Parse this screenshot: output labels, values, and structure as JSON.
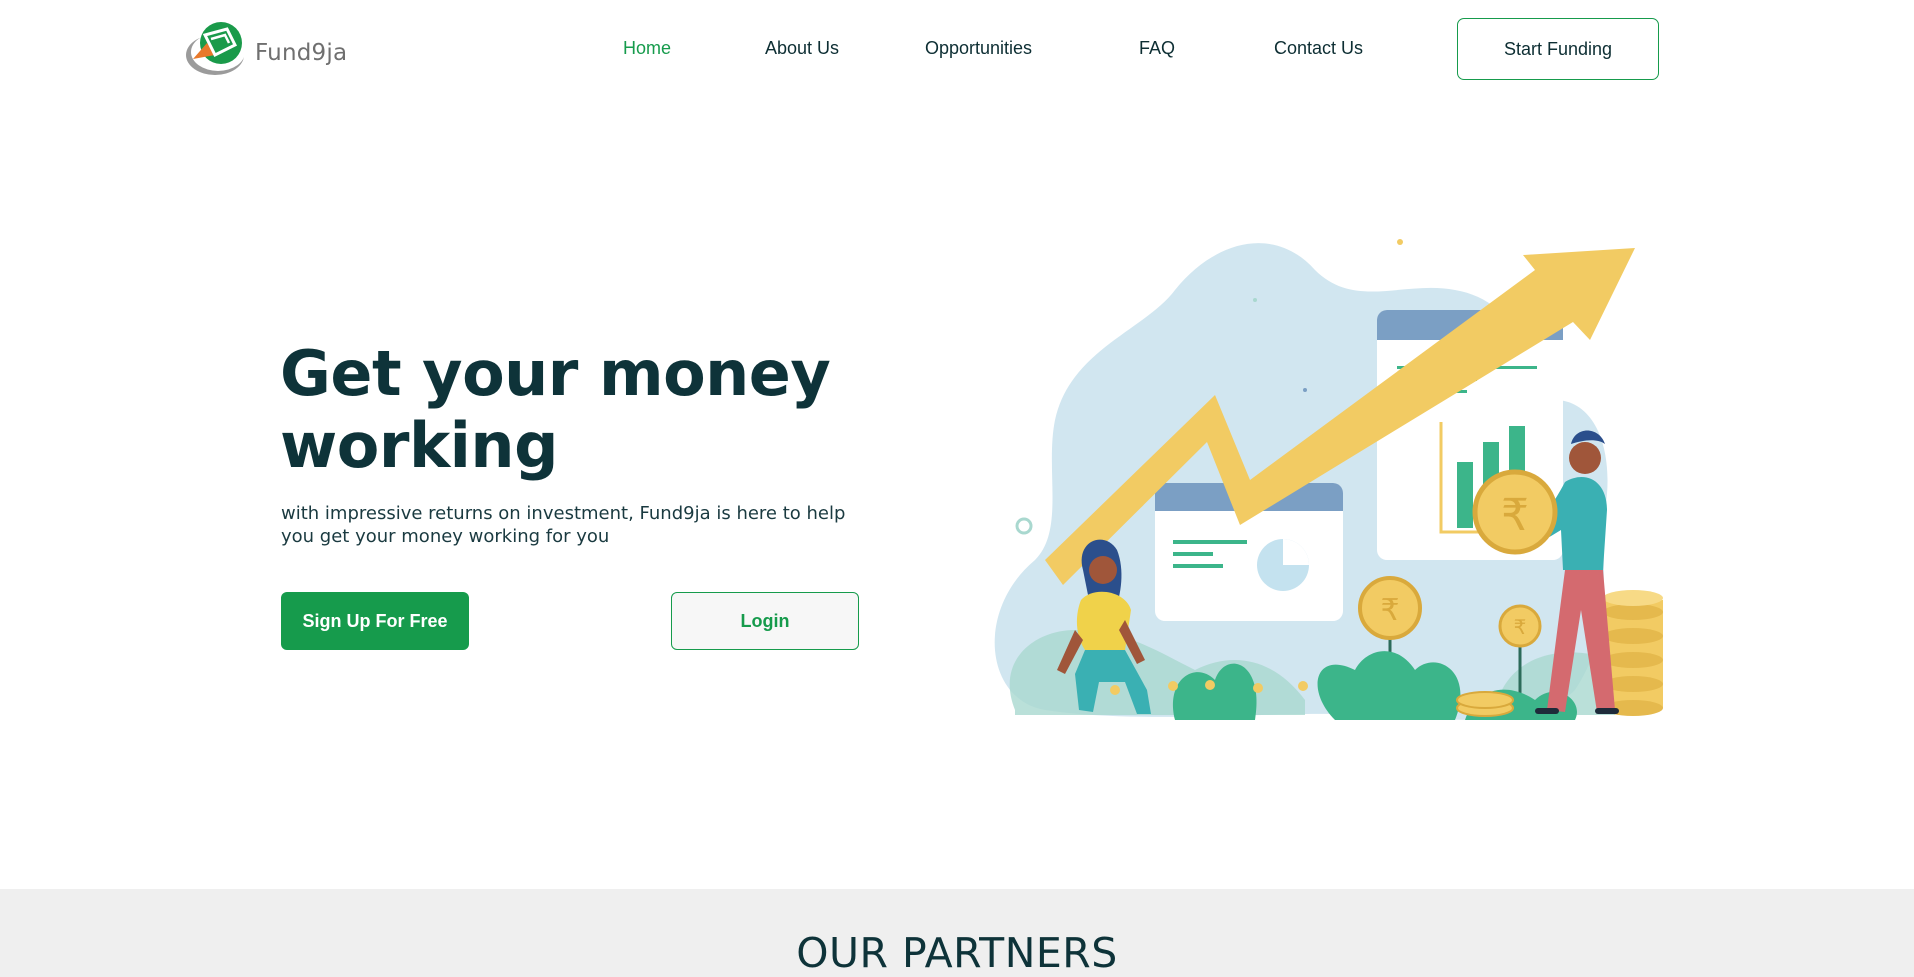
{
  "brand": {
    "name": "Fund9ja",
    "logo_icon": "fund9ja-logo-icon",
    "colors": {
      "primary_green": "#169b4c",
      "dark_text": "#0e3339",
      "accent_yellow": "#f2cb63",
      "accent_orange": "#e8792b"
    }
  },
  "nav": {
    "items": [
      {
        "label": "Home",
        "active": true
      },
      {
        "label": "About Us",
        "active": false
      },
      {
        "label": "Opportunities",
        "active": false
      },
      {
        "label": "FAQ",
        "active": false
      },
      {
        "label": "Contact Us",
        "active": false
      }
    ],
    "cta_label": "Start Funding"
  },
  "hero": {
    "title": "Get your money working",
    "subtitle": "with impressive returns on investment, Fund9ja is here to help you get your money working for you",
    "signup_label": "Sign Up For Free",
    "login_label": "Login",
    "illustration": "investment-growth-illustration"
  },
  "partners": {
    "title": "OUR PARTNERS"
  }
}
